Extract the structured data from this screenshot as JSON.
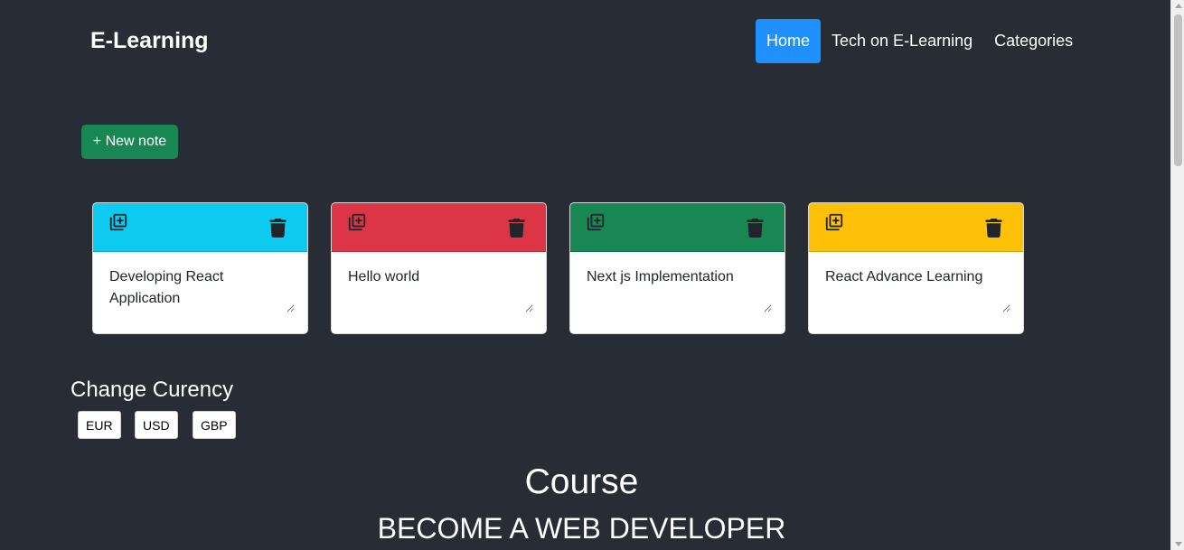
{
  "navbar": {
    "brand": "E-Learning",
    "links": [
      {
        "label": "Home",
        "active": true
      },
      {
        "label": "Tech on E-Learning",
        "active": false
      },
      {
        "label": "Categories",
        "active": false
      }
    ]
  },
  "new_note_label": "+ New note",
  "notes": [
    {
      "text": "Developing React Application",
      "color": "#0dcaf0"
    },
    {
      "text": "Hello world",
      "color": "#dc3545"
    },
    {
      "text": "Next js Implementation",
      "color": "#198754"
    },
    {
      "text": "React Advance Learning",
      "color": "#ffc107"
    }
  ],
  "currency": {
    "title": "Change Curency",
    "options": [
      "EUR",
      "USD",
      "GBP"
    ]
  },
  "course": {
    "title": "Course",
    "subtitle": "BECOME A WEB DEVELOPER"
  },
  "icons": {
    "add": "library-add-icon",
    "delete": "trash-icon"
  },
  "colors": {
    "background": "#282c34",
    "nav_active": "#1e90ff",
    "new_note": "#198754"
  }
}
